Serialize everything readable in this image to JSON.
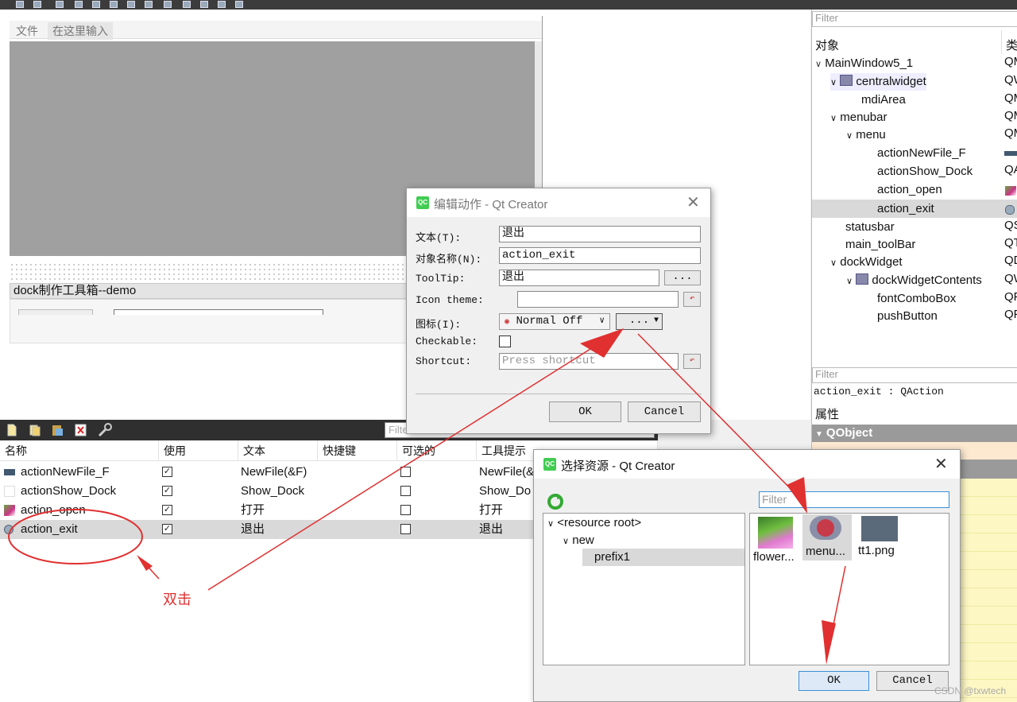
{
  "form": {
    "menu_items": [
      "文件",
      "在这里输入"
    ],
    "dock_title": "dock制作工具箱--demo"
  },
  "action_editor": {
    "filter_placeholder": "Filter",
    "columns": [
      "名称",
      "使用",
      "文本",
      "快捷键",
      "可选的",
      "工具提示"
    ],
    "rows": [
      {
        "name": "actionNewFile_F",
        "used": true,
        "text": "NewFile(&F)",
        "shortcut": "",
        "checkable": false,
        "tooltip": "NewFile(&F"
      },
      {
        "name": "actionShow_Dock",
        "used": true,
        "text": "Show_Dock",
        "shortcut": "",
        "checkable": false,
        "tooltip": "Show_Do"
      },
      {
        "name": "action_open",
        "used": true,
        "text": "打开",
        "shortcut": "",
        "checkable": false,
        "tooltip": "打开"
      },
      {
        "name": "action_exit",
        "used": true,
        "text": "退出",
        "shortcut": "",
        "checkable": false,
        "tooltip": "退出"
      }
    ]
  },
  "annotation": {
    "double_click": "双击"
  },
  "object_inspector": {
    "filter_placeholder": "Filter",
    "col_object": "对象",
    "col_class": "类",
    "tree": [
      {
        "label": "MainWindow5_1",
        "cls": "QM"
      },
      {
        "label": "centralwidget",
        "cls": "QW"
      },
      {
        "label": "mdiArea",
        "cls": "QM"
      },
      {
        "label": "menubar",
        "cls": "QM"
      },
      {
        "label": "menu",
        "cls": "QM"
      },
      {
        "label": "actionNewFile_F",
        "cls": ""
      },
      {
        "label": "actionShow_Dock",
        "cls": "QA"
      },
      {
        "label": "action_open",
        "cls": ""
      },
      {
        "label": "action_exit",
        "cls": ""
      },
      {
        "label": "statusbar",
        "cls": "QS"
      },
      {
        "label": "main_toolBar",
        "cls": "QT"
      },
      {
        "label": "dockWidget",
        "cls": "QD"
      },
      {
        "label": "dockWidgetContents",
        "cls": "QW"
      },
      {
        "label": "fontComboBox",
        "cls": "QF"
      },
      {
        "label": "pushButton",
        "cls": "QF"
      }
    ]
  },
  "property_editor": {
    "filter_placeholder": "Filter",
    "object_line": "action_exit : QAction",
    "header": "属性",
    "group": "QObject"
  },
  "edit_action_dialog": {
    "title": "编辑动作 - Qt Creator",
    "text_label": "文本(T):",
    "text_value": "退出",
    "objname_label": "对象名称(N):",
    "objname_value": "action_exit",
    "tooltip_label": "ToolTip:",
    "tooltip_value": "退出",
    "icon_theme_label": "Icon theme:",
    "icon_label": "图标(I):",
    "icon_mode": "Normal Off",
    "browse": "...",
    "checkable_label": "Checkable:",
    "shortcut_label": "Shortcut:",
    "shortcut_placeholder": "Press shortcut",
    "ok": "OK",
    "cancel": "Cancel"
  },
  "select_resource_dialog": {
    "title": "选择资源 - Qt Creator",
    "filter_placeholder": "Filter",
    "tree": [
      "<resource root>",
      "new",
      "prefix1"
    ],
    "files": [
      "flower...",
      "menu...",
      "tt1.png"
    ],
    "ok": "OK",
    "cancel": "Cancel"
  },
  "watermark": "CSDN @txwtech",
  "colors": {
    "arrow": "#e03030",
    "selection": "#d9d9d9",
    "qc_green": "#41cd52",
    "panel_gray": "#a0a0a0"
  }
}
